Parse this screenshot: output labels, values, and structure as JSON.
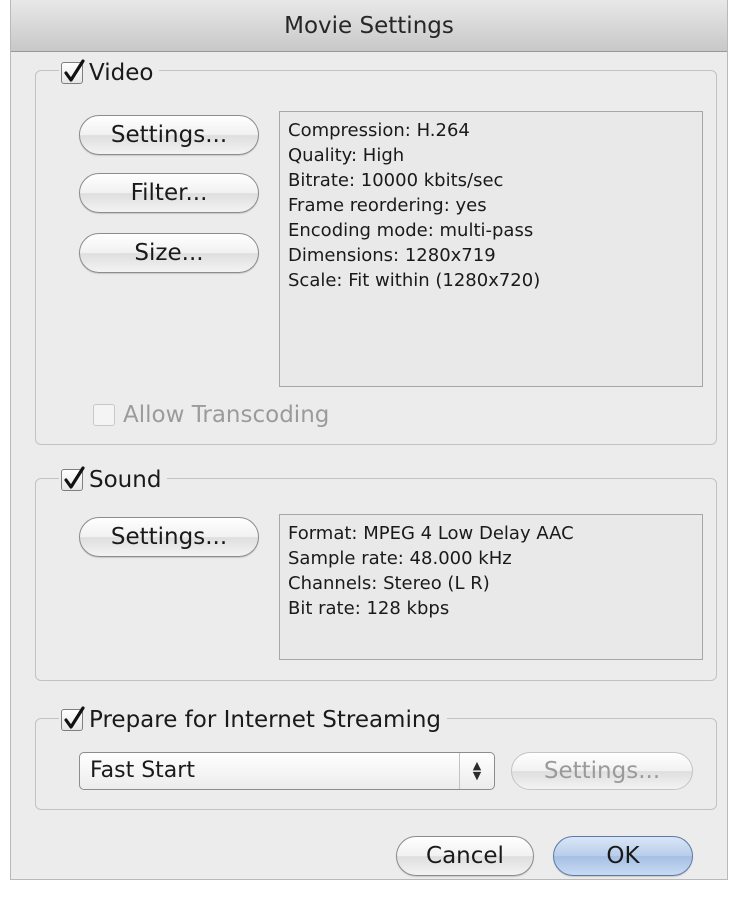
{
  "window": {
    "title": "Movie Settings"
  },
  "video": {
    "label": "Video",
    "checked": true,
    "buttons": {
      "settings": "Settings...",
      "filter": "Filter...",
      "size": "Size..."
    },
    "info": [
      "Compression: H.264",
      "Quality: High",
      "Bitrate: 10000 kbits/sec",
      "Frame reordering: yes",
      "Encoding mode: multi-pass",
      "Dimensions: 1280x719",
      "Scale: Fit within (1280x720)"
    ],
    "allow_transcoding": {
      "label": "Allow Transcoding",
      "checked": false,
      "enabled": false
    }
  },
  "sound": {
    "label": "Sound",
    "checked": true,
    "buttons": {
      "settings": "Settings..."
    },
    "info": [
      "Format: MPEG 4 Low Delay AAC",
      "Sample rate: 48.000 kHz",
      "Channels: Stereo (L R)",
      "Bit rate: 128 kbps"
    ]
  },
  "streaming": {
    "label": "Prepare for Internet Streaming",
    "checked": true,
    "selected_option": "Fast Start",
    "settings_label": "Settings...",
    "settings_enabled": false
  },
  "footer": {
    "cancel_label": "Cancel",
    "ok_label": "OK"
  },
  "colors": {
    "window_bg": "#ececec",
    "ok_button": "#b8cde9"
  }
}
